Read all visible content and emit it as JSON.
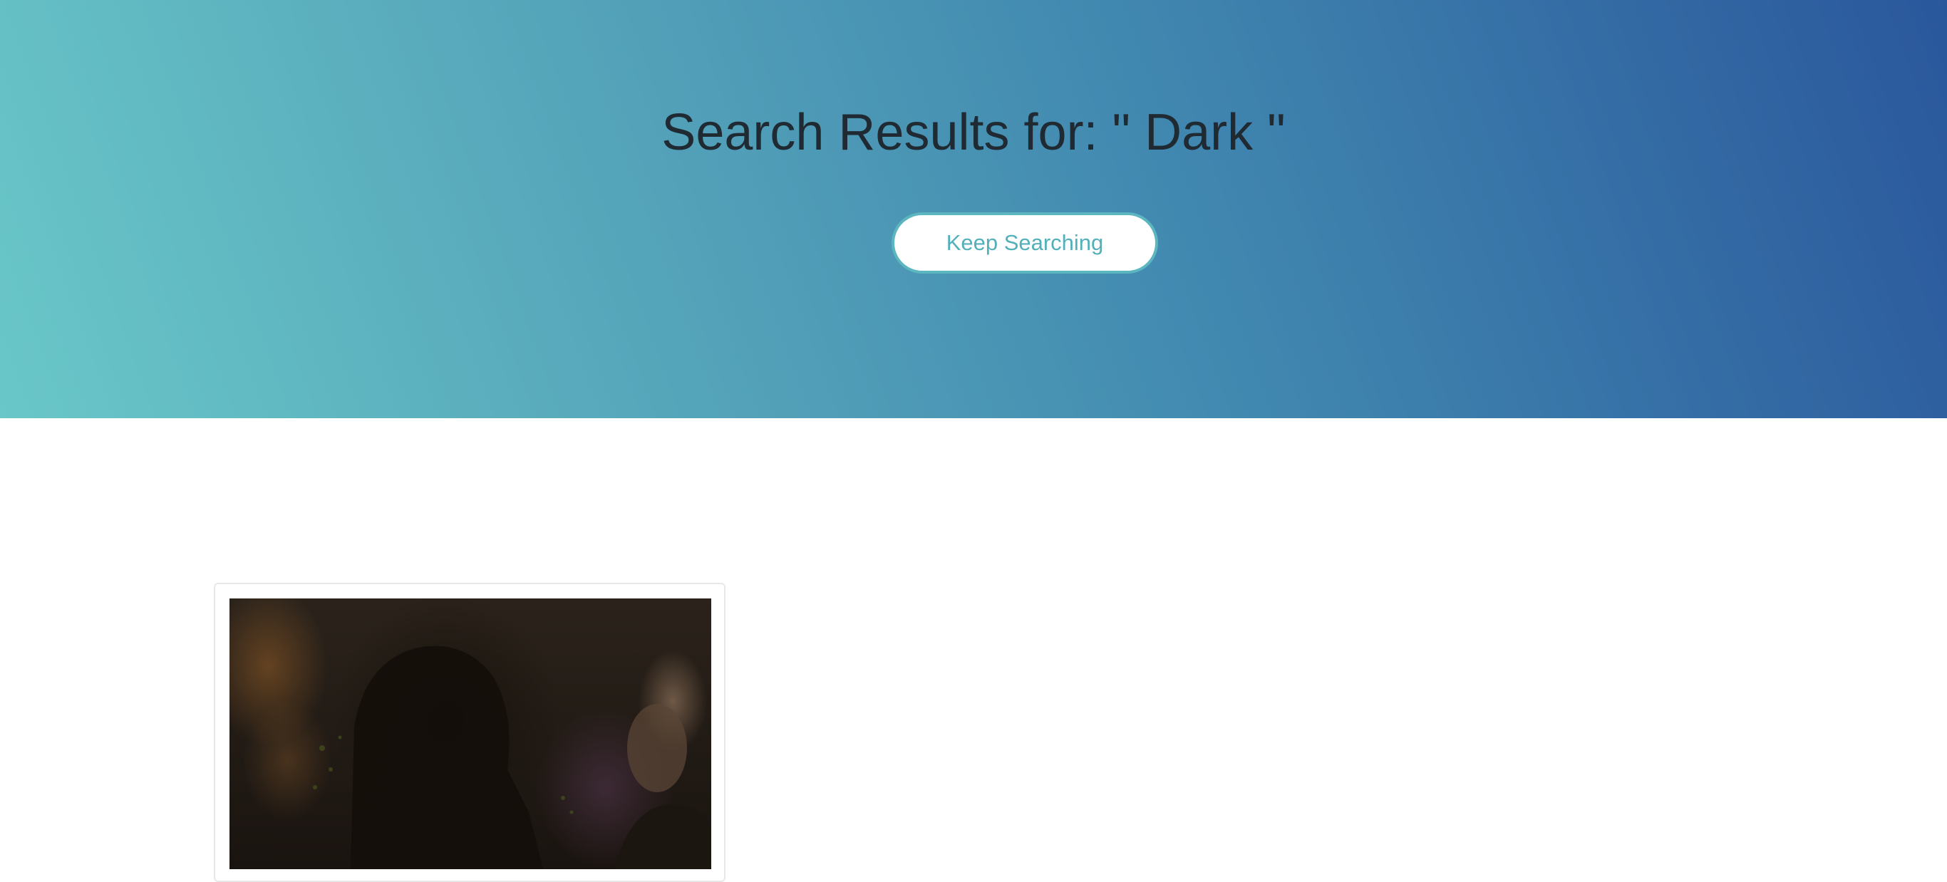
{
  "hero": {
    "title": "Search Results for: \" Dark \"",
    "button_label": "Keep Searching",
    "colors": {
      "gradient_start": "#69c7c8",
      "gradient_end": "#2a579c",
      "button_text": "#52b0ba"
    }
  },
  "results": [
    {
      "thumbnail_icon": "movie-still-image"
    }
  ]
}
